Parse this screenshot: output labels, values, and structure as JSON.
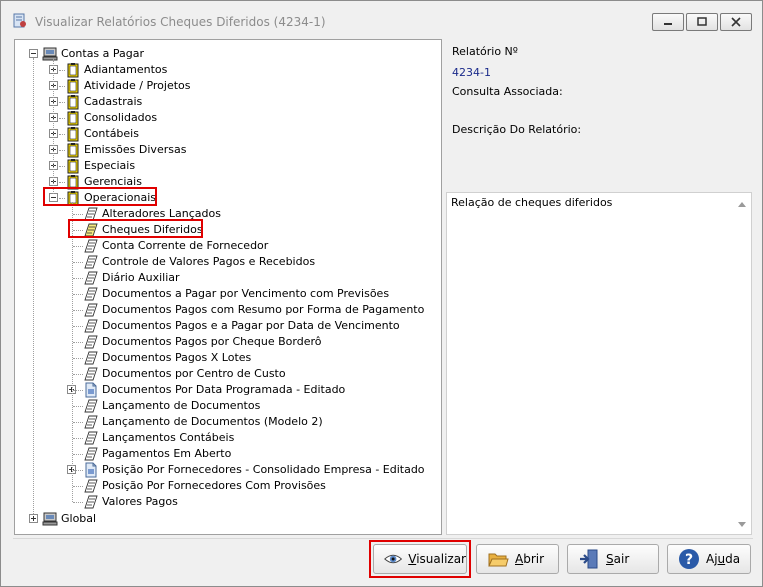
{
  "window": {
    "title": "Visualizar Relatórios Cheques Diferidos (4234-1)"
  },
  "tree": {
    "root": {
      "label": "Contas a Pagar"
    },
    "categories": [
      {
        "label": "Adiantamentos"
      },
      {
        "label": "Atividade / Projetos"
      },
      {
        "label": "Cadastrais"
      },
      {
        "label": "Consolidados"
      },
      {
        "label": "Contábeis"
      },
      {
        "label": "Emissões Diversas"
      },
      {
        "label": "Especiais"
      },
      {
        "label": "Gerenciais"
      },
      {
        "label": "Operacionais"
      }
    ],
    "reports": [
      {
        "label": "Alteradores Lançados"
      },
      {
        "label": "Cheques Diferidos"
      },
      {
        "label": "Conta Corrente de Fornecedor"
      },
      {
        "label": "Controle de Valores Pagos e Recebidos"
      },
      {
        "label": "Diário Auxiliar"
      },
      {
        "label": "Documentos a Pagar por Vencimento com Previsões"
      },
      {
        "label": "Documentos Pagos com Resumo por Forma de Pagamento"
      },
      {
        "label": "Documentos Pagos e a Pagar por Data de Vencimento"
      },
      {
        "label": "Documentos Pagos por Cheque Borderô"
      },
      {
        "label": "Documentos Pagos X Lotes"
      },
      {
        "label": "Documentos por Centro de Custo"
      },
      {
        "label": "Documentos Por Data Programada - Editado"
      },
      {
        "label": "Lançamento de Documentos"
      },
      {
        "label": "Lançamento de Documentos (Modelo 2)"
      },
      {
        "label": "Lançamentos Contábeis"
      },
      {
        "label": "Pagamentos Em Aberto"
      },
      {
        "label": "Posição Por Fornecedores - Consolidado Empresa - Editado"
      },
      {
        "label": "Posição Por Fornecedores Com Provisões"
      },
      {
        "label": "Valores Pagos"
      }
    ],
    "global": {
      "label": "Global"
    }
  },
  "info": {
    "report_number_label": "Relatório Nº",
    "report_number_value": "4234-1",
    "associated_query_label": "Consulta Associada:",
    "description_label": "Descrição Do Relatório:",
    "description_text": "Relação de cheques diferidos"
  },
  "buttons": {
    "view": {
      "prefix": "",
      "accel": "V",
      "rest": "isualizar"
    },
    "open": {
      "prefix": "",
      "accel": "A",
      "rest": "brir"
    },
    "exit": {
      "prefix": "",
      "accel": "S",
      "rest": "air"
    },
    "help": {
      "prefix": "Aj",
      "accel": "u",
      "rest": "da"
    }
  },
  "colors": {
    "highlight": "#e00000",
    "folder": "#f2d600",
    "link": "#1a2a8a"
  }
}
